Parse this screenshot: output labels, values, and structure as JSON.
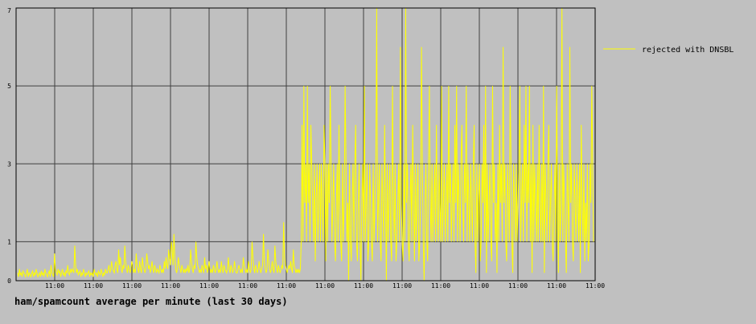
{
  "chart_data": {
    "type": "line",
    "title": "ham/spamcount average per minute (last 30 days)",
    "xlabel": "",
    "ylabel": "",
    "x_tick_labels": [
      "11:00",
      "11:00",
      "11:00",
      "11:00",
      "11:00",
      "11:00",
      "11:00",
      "11:00",
      "11:00",
      "11:00",
      "11:00",
      "11:00",
      "11:00",
      "11:00",
      "11:00"
    ],
    "y_ticks": [
      0,
      1,
      3,
      5,
      7
    ],
    "y_tick_labels": [
      "0",
      "1",
      "3",
      "5",
      "7"
    ],
    "ylim": [
      0,
      7
    ],
    "grid": true,
    "legend_position": "right",
    "background_color": "#c0c0c0",
    "grid_color": "#404040",
    "series": [
      {
        "name": "rejected with DNSBL",
        "color": "#ffff00",
        "values": [
          0.2,
          0.1,
          0.3,
          0.15,
          0.2,
          0.1,
          0.25,
          0.2,
          0.15,
          0.1,
          0.2,
          0.3,
          0.1,
          0.2,
          0.15,
          0.1,
          0.2,
          0.25,
          0.1,
          0.2,
          0.15,
          0.3,
          0.2,
          0.1,
          0.15,
          0.2,
          0.1,
          0.25,
          0.15,
          0.2,
          0.1,
          0.3,
          0.2,
          0.15,
          0.1,
          0.2,
          0.25,
          0.1,
          0.4,
          0.2,
          0.15,
          0.1,
          0.7,
          0.3,
          0.2,
          0.15,
          0.3,
          0.2,
          0.25,
          0.1,
          0.2,
          0.3,
          0.15,
          0.2,
          0.1,
          0.25,
          0.2,
          0.4,
          0.2,
          0.15,
          0.3,
          0.2,
          0.3,
          0.25,
          0.2,
          0.9,
          0.4,
          0.2,
          0.3,
          0.15,
          0.2,
          0.25,
          0.1,
          0.2,
          0.15,
          0.3,
          0.2,
          0.1,
          0.2,
          0.15,
          0.2,
          0.25,
          0.1,
          0.2,
          0.15,
          0.2,
          0.1,
          0.3,
          0.2,
          0.15,
          0.2,
          0.1,
          0.25,
          0.2,
          0.15,
          0.3,
          0.2,
          0.1,
          0.2,
          0.15,
          0.3,
          0.2,
          0.2,
          0.3,
          0.4,
          0.2,
          0.3,
          0.5,
          0.3,
          0.25,
          0.2,
          0.4,
          0.5,
          0.3,
          0.2,
          0.8,
          0.4,
          0.6,
          0.3,
          0.2,
          0.4,
          0.3,
          0.9,
          0.5,
          0.3,
          0.2,
          0.4,
          0.3,
          0.2,
          0.3,
          0.5,
          0.4,
          0.2,
          0.3,
          0.2,
          0.7,
          0.4,
          0.3,
          0.2,
          0.5,
          0.3,
          0.2,
          0.6,
          0.4,
          0.3,
          0.2,
          0.3,
          0.7,
          0.5,
          0.3,
          0.4,
          0.2,
          0.3,
          0.5,
          0.3,
          0.2,
          0.4,
          0.3,
          0.2,
          0.3,
          0.25,
          0.2,
          0.4,
          0.3,
          0.2,
          0.3,
          0.2,
          0.5,
          0.3,
          0.6,
          0.4,
          0.3,
          0.8,
          0.6,
          0.4,
          1.0,
          0.8,
          0.4,
          1.2,
          0.6,
          0.3,
          0.2,
          0.3,
          0.6,
          0.4,
          0.3,
          0.2,
          0.4,
          0.3,
          0.2,
          0.3,
          0.2,
          0.3,
          0.25,
          0.4,
          0.2,
          0.3,
          0.8,
          0.5,
          0.3,
          0.2,
          0.4,
          0.3,
          1.0,
          0.6,
          0.4,
          0.3,
          0.2,
          0.3,
          0.2,
          0.4,
          0.3,
          0.2,
          0.6,
          0.3,
          0.4,
          0.2,
          0.3,
          0.5,
          0.3,
          0.2,
          0.3,
          0.2,
          0.4,
          0.3,
          0.2,
          0.3,
          0.5,
          0.3,
          0.2,
          0.3,
          0.2,
          0.5,
          0.3,
          0.2,
          0.4,
          0.3,
          0.25,
          0.2,
          0.3,
          0.6,
          0.3,
          0.2,
          0.4,
          0.3,
          0.2,
          0.3,
          0.5,
          0.3,
          0.2,
          0.2,
          0.3,
          0.4,
          0.3,
          0.2,
          0.3,
          0.2,
          0.6,
          0.4,
          0.3,
          0.2,
          0.3,
          0.2,
          0.5,
          0.3,
          0.2,
          0.3,
          1.0,
          0.6,
          0.3,
          0.2,
          0.4,
          0.3,
          0.2,
          0.3,
          0.5,
          0.3,
          0.2,
          0.3,
          0.4,
          1.2,
          0.5,
          0.3,
          0.2,
          0.3,
          0.8,
          0.5,
          0.3,
          0.2,
          0.3,
          0.5,
          0.3,
          0.2,
          0.9,
          0.5,
          0.3,
          0.2,
          0.4,
          0.3,
          0.2,
          0.3,
          0.4,
          0.3,
          1.5,
          0.6,
          0.4,
          0.3,
          0.2,
          0.3,
          0.4,
          0.3,
          0.5,
          0.3,
          0.2,
          0.8,
          0.4,
          0.3,
          0.2,
          0.3,
          0.2,
          0.3,
          0.2,
          0.3,
          1.0,
          4.0,
          1.0,
          5.0,
          2.0,
          3.0,
          1.0,
          5.0,
          2.0,
          3.0,
          1.0,
          4.0,
          3.0,
          2.0,
          1.0,
          3.0,
          0.5,
          2.0,
          3.0,
          1.0,
          2.0,
          3.0,
          1.0,
          3.0,
          2.0,
          1.0,
          4.0,
          3.0,
          0.5,
          3.0,
          1.0,
          3.0,
          2.0,
          5.0,
          3.0,
          1.0,
          2.0,
          3.0,
          1.0,
          0.5,
          2.0,
          3.0,
          1.0,
          4.0,
          2.0,
          1.0,
          0.5,
          3.0,
          1.0,
          2.0,
          5.0,
          3.0,
          1.0,
          2.0,
          0.0,
          3.0,
          1.0,
          0.5,
          2.0,
          3.0,
          1.0,
          3.0,
          4.0,
          1.0,
          0.5,
          2.0,
          3.0,
          1.0,
          0.0,
          2.0,
          3.0,
          1.0,
          5.0,
          1.0,
          2.0,
          3.0,
          0.5,
          1.0,
          3.0,
          2.0,
          1.0,
          0.5,
          3.0,
          1.0,
          2.0,
          3.0,
          7.0,
          1.0,
          2.0,
          3.0,
          1.0,
          0.5,
          3.0,
          2.0,
          1.0,
          4.0,
          2.0,
          0.0,
          3.0,
          1.0,
          2.0,
          3.0,
          1.0,
          0.5,
          5.0,
          2.0,
          1.0,
          3.0,
          0.5,
          1.0,
          2.0,
          3.0,
          1.0,
          6.0,
          2.0,
          1.0,
          0.5,
          3.0,
          1.0,
          7.0,
          2.0,
          3.0,
          1.0,
          0.5,
          2.0,
          3.0,
          1.0,
          4.0,
          2.0,
          0.5,
          3.0,
          1.0,
          2.0,
          3.0,
          0.5,
          1.0,
          2.0,
          6.0,
          3.0,
          1.0,
          0.0,
          2.0,
          3.0,
          1.0,
          0.5,
          3.0,
          5.0,
          2.0,
          1.0,
          3.0,
          1.0,
          2.0,
          3.0,
          1.0,
          4.0,
          2.0,
          1.0,
          3.0,
          2.0,
          1.0,
          5.0,
          1.0,
          2.0,
          3.0,
          1.0,
          2.0,
          3.0,
          1.0,
          5.0,
          2.0,
          3.0,
          1.0,
          2.0,
          3.0,
          1.0,
          4.0,
          2.0,
          5.0,
          1.0,
          3.0,
          2.0,
          1.0,
          3.0,
          4.0,
          2.0,
          1.0,
          3.0,
          2.0,
          5.0,
          1.0,
          3.0,
          2.0,
          1.0,
          3.0,
          2.0,
          1.0,
          3.0,
          4.0,
          1.0,
          0.2,
          3.0,
          1.0,
          2.0,
          3.0,
          0.5,
          1.0,
          3.0,
          2.0,
          4.0,
          1.0,
          5.0,
          0.2,
          3.0,
          1.0,
          2.0,
          3.0,
          1.0,
          0.5,
          5.0,
          2.0,
          3.0,
          1.0,
          2.0,
          0.2,
          3.0,
          1.0,
          4.0,
          2.0,
          3.0,
          1.0,
          6.0,
          2.0,
          3.0,
          1.0,
          0.5,
          3.0,
          2.0,
          1.0,
          5.0,
          3.0,
          1.0,
          0.2,
          3.0,
          2.0,
          1.0,
          3.0,
          1.0,
          2.0,
          3.0,
          5.0,
          1.0,
          2.0,
          3.0,
          1.0,
          4.0,
          2.0,
          5.0,
          1.0,
          3.0,
          2.0,
          5.0,
          1.0,
          3.0,
          0.2,
          4.0,
          1.0,
          3.0,
          2.0,
          1.0,
          3.0,
          1.0,
          4.0,
          2.0,
          1.0,
          3.0,
          1.0,
          5.0,
          0.2,
          3.0,
          2.0,
          1.0,
          3.0,
          4.0,
          1.0,
          2.0,
          3.0,
          1.0,
          0.5,
          2.0,
          3.0,
          1.0,
          5.0,
          2.0,
          0.2,
          3.0,
          1.0,
          2.0,
          7.0,
          1.0,
          3.0,
          2.0,
          1.0,
          0.2,
          3.0,
          2.0,
          1.0,
          6.0,
          2.0,
          3.0,
          1.0,
          0.5,
          3.0,
          2.0,
          1.0,
          3.0,
          2.0,
          1.0,
          3.0,
          0.2,
          4.0,
          2.0,
          1.0,
          3.0,
          0.5,
          2.0,
          1.0,
          3.0,
          0.5,
          1.0,
          3.0,
          2.0,
          5.0,
          3.0,
          1.0
        ]
      }
    ]
  }
}
